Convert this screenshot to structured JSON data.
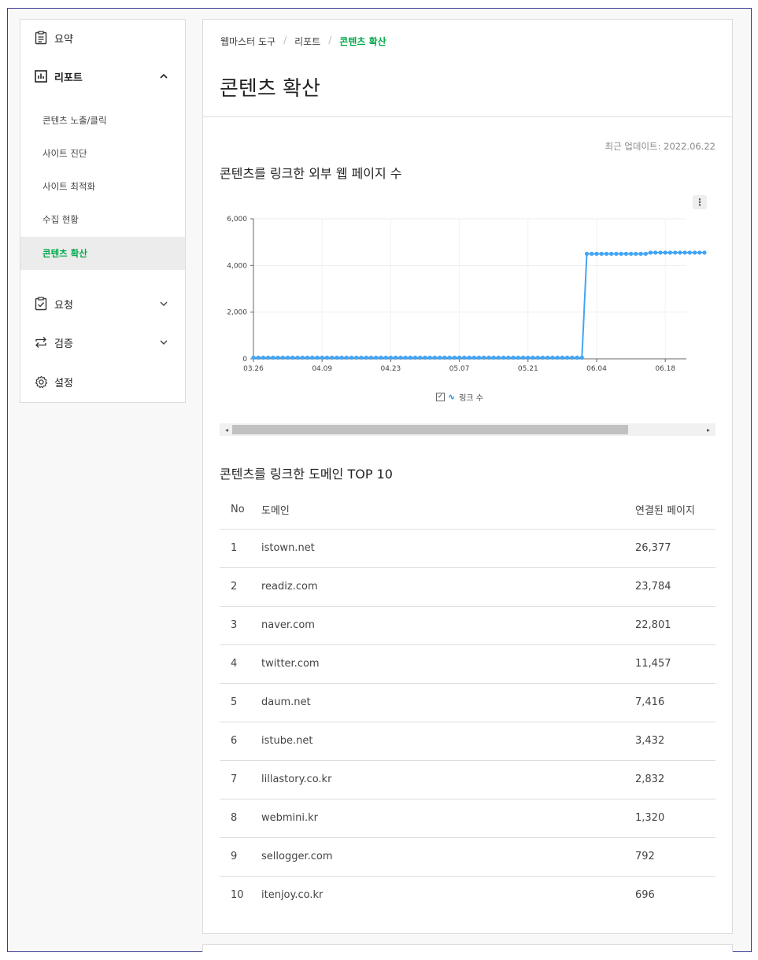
{
  "sidebar": {
    "summary": "요약",
    "report": "리포트",
    "report_items": [
      "콘텐츠 노출/클릭",
      "사이트 진단",
      "사이트 최적화",
      "수집 현황",
      "콘텐츠 확산"
    ],
    "active_item": "콘텐츠 확산",
    "request": "요청",
    "verify": "검증",
    "settings": "설정",
    "icons": [
      "clipboard-icon",
      "bar-chart-icon",
      "checklist-icon",
      "swap-icon",
      "gear-icon"
    ]
  },
  "breadcrumb": [
    "웹마스터 도구",
    "리포트",
    "콘텐츠 확산"
  ],
  "page_title": "콘텐츠 확산",
  "updated": "최근 업데이트: 2022.06.22",
  "chart_section_title": "콘텐츠를 링크한 외부 웹 페이지 수",
  "menu_glyph": "⋮",
  "colors": {
    "accent": "#03a94b",
    "line": "#42a5f5"
  },
  "chart_data": {
    "type": "line",
    "x_ticks": [
      "03.26",
      "04.09",
      "04.23",
      "05.07",
      "05.21",
      "06.04",
      "06.18"
    ],
    "y_ticks": [
      "0",
      "2,000",
      "4,000",
      "6,000"
    ],
    "ylim": [
      0,
      6000
    ],
    "grid": true,
    "legend_position": "bottom",
    "series": [
      {
        "name": "링크 수",
        "x_start": "03.26",
        "values": [
          50,
          50,
          50,
          50,
          50,
          50,
          50,
          50,
          50,
          50,
          50,
          50,
          50,
          50,
          50,
          50,
          50,
          50,
          50,
          50,
          50,
          50,
          50,
          50,
          50,
          50,
          50,
          50,
          50,
          50,
          50,
          50,
          50,
          50,
          50,
          50,
          50,
          50,
          50,
          50,
          50,
          50,
          50,
          50,
          50,
          50,
          50,
          50,
          50,
          50,
          50,
          50,
          50,
          50,
          50,
          50,
          50,
          50,
          50,
          50,
          50,
          50,
          50,
          50,
          50,
          50,
          50,
          50,
          4500,
          4500,
          4500,
          4500,
          4500,
          4500,
          4500,
          4500,
          4500,
          4500,
          4500,
          4500,
          4500,
          4550,
          4550,
          4550,
          4550,
          4550,
          4550,
          4550,
          4550,
          4550,
          4550,
          4550,
          4550
        ]
      }
    ]
  },
  "legend": {
    "check": "✓",
    "symbol": "∿",
    "label": "링크 수"
  },
  "scroll": {
    "left": "◂",
    "right": "▸"
  },
  "table_title": "콘텐츠를 링크한 도메인 TOP 10",
  "table": {
    "headers": [
      "No",
      "도메인",
      "연결된 페이지"
    ],
    "rows": [
      [
        "1",
        "istown.net",
        "26,377"
      ],
      [
        "2",
        "readiz.com",
        "23,784"
      ],
      [
        "3",
        "naver.com",
        "22,801"
      ],
      [
        "4",
        "twitter.com",
        "11,457"
      ],
      [
        "5",
        "daum.net",
        "7,416"
      ],
      [
        "6",
        "istube.net",
        "3,432"
      ],
      [
        "7",
        "lillastory.co.kr",
        "2,832"
      ],
      [
        "8",
        "webmini.kr",
        "1,320"
      ],
      [
        "9",
        "sellogger.com",
        "792"
      ],
      [
        "10",
        "itenjoy.co.kr",
        "696"
      ]
    ]
  }
}
